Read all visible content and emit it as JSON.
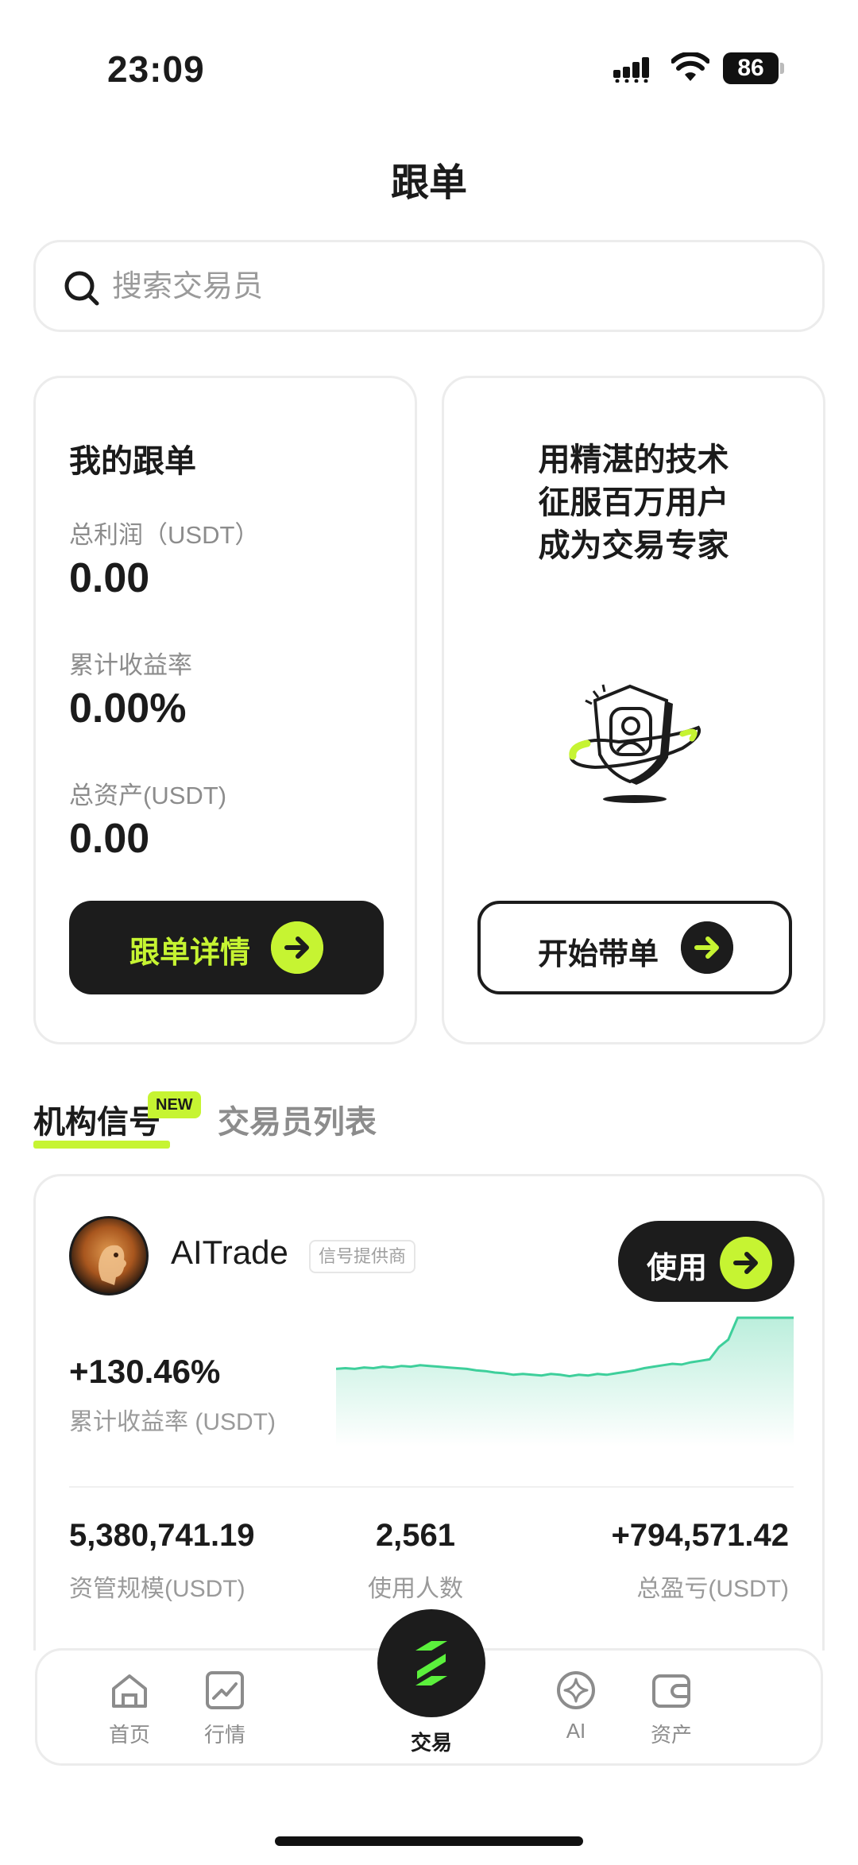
{
  "status_bar": {
    "time": "23:09",
    "battery": "86"
  },
  "page": {
    "title": "跟单"
  },
  "search": {
    "placeholder": "搜索交易员"
  },
  "my_copy": {
    "title": "我的跟单",
    "stats": [
      {
        "label": "总利润（USDT）",
        "value": "0.00"
      },
      {
        "label": "累计收益率",
        "value": "0.00%"
      },
      {
        "label": "总资产(USDT)",
        "value": "0.00"
      }
    ],
    "detail_button": "跟单详情"
  },
  "promo": {
    "line1": "用精湛的技术",
    "line2": "征服百万用户",
    "line3": "成为交易专家",
    "start_button": "开始带单"
  },
  "tabs": {
    "active": "机构信号",
    "badge": "NEW",
    "inactive": "交易员列表"
  },
  "signal": {
    "name": "AITrade",
    "tag": "信号提供商",
    "use_button": "使用",
    "roi": "+130.46%",
    "roi_label": "累计收益率 (USDT)",
    "chart_data": {
      "type": "area",
      "values": [
        0.3,
        0.31,
        0.3,
        0.32,
        0.31,
        0.33,
        0.32,
        0.34,
        0.33,
        0.35,
        0.34,
        0.33,
        0.32,
        0.31,
        0.3,
        0.28,
        0.27,
        0.25,
        0.24,
        0.22,
        0.23,
        0.22,
        0.21,
        0.23,
        0.22,
        0.2,
        0.22,
        0.21,
        0.23,
        0.22,
        0.24,
        0.26,
        0.28,
        0.31,
        0.33,
        0.35,
        0.37,
        0.36,
        0.39,
        0.41,
        0.43,
        0.6,
        0.7,
        1.0,
        1.0,
        1.0,
        1.0,
        1.0,
        1.0,
        1.0
      ],
      "color": "#3ecf9b"
    },
    "metrics": [
      {
        "value": "5,380,741.19",
        "label": "资管规模(USDT)"
      },
      {
        "value": "2,561",
        "label": "使用人数"
      },
      {
        "value": "+794,571.42",
        "label": "总盈亏(USDT)"
      }
    ]
  },
  "nav": {
    "home": "首页",
    "market": "行情",
    "trade": "交易",
    "ai": "AI",
    "assets": "资产"
  },
  "colors": {
    "accent": "#c6f432",
    "dark": "#1c1c1c",
    "chart": "#3ecf9b"
  }
}
